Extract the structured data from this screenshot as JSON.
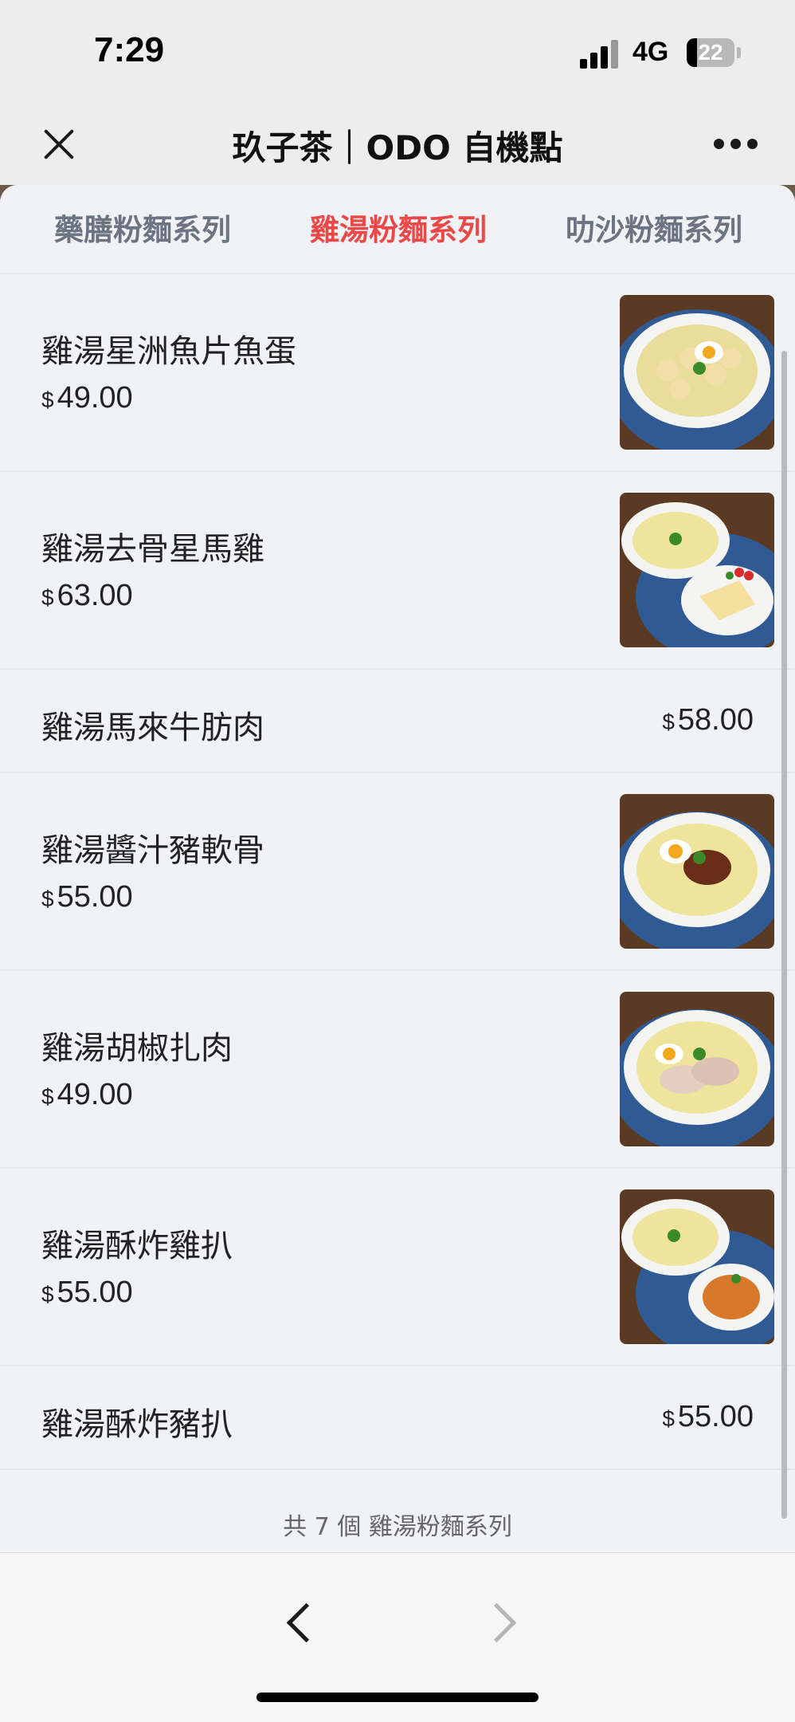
{
  "status": {
    "time": "7:29",
    "network": "4G",
    "battery": "22",
    "battery_level": 0.22
  },
  "nav": {
    "title": "玖子茶｜ODO 自機點",
    "close_icon": "close-icon",
    "more_icon": "more-dots-icon"
  },
  "tabs": [
    {
      "label": "藥膳粉麵系列",
      "active": false
    },
    {
      "label": "雞湯粉麵系列",
      "active": true
    },
    {
      "label": "叻沙粉麵系列",
      "active": false
    }
  ],
  "items": [
    {
      "name": "雞湯星洲魚片魚蛋",
      "currency": "$",
      "price": "49.00",
      "has_image": true
    },
    {
      "name": "雞湯去骨星馬雞",
      "currency": "$",
      "price": "63.00",
      "has_image": true
    },
    {
      "name": "雞湯馬來牛肪肉",
      "currency": "$",
      "price": "58.00",
      "has_image": false
    },
    {
      "name": "雞湯醬汁豬軟骨",
      "currency": "$",
      "price": "55.00",
      "has_image": true
    },
    {
      "name": "雞湯胡椒扎肉",
      "currency": "$",
      "price": "49.00",
      "has_image": true
    },
    {
      "name": "雞湯酥炸雞扒",
      "currency": "$",
      "price": "55.00",
      "has_image": true
    },
    {
      "name": "雞湯酥炸豬扒",
      "currency": "$",
      "price": "55.00",
      "has_image": false
    }
  ],
  "footer": {
    "count_text": "共 7 個 雞湯粉麵系列"
  },
  "bottom_nav": {
    "back_icon": "chevron-left-icon",
    "forward_icon": "chevron-right-icon"
  },
  "colors": {
    "accent": "#ec4848",
    "tab_inactive": "#6b7480",
    "bowl_blue": "#2f5a94"
  }
}
